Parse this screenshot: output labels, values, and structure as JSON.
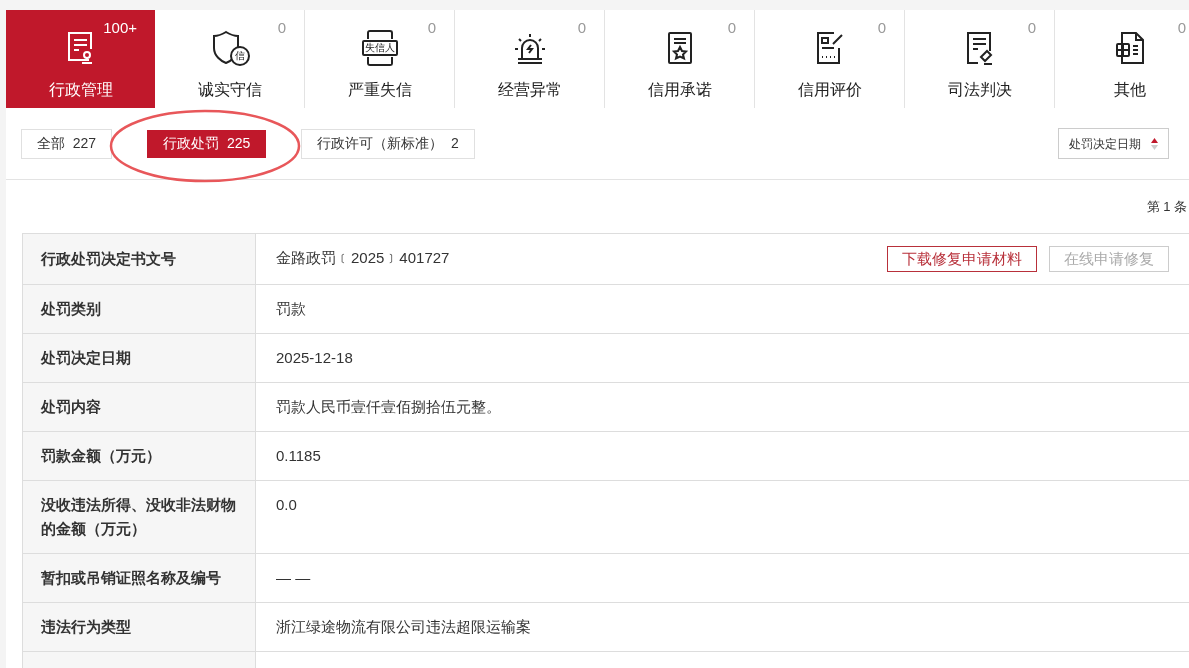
{
  "categories": [
    {
      "label": "行政管理",
      "count": "100+",
      "selected": true
    },
    {
      "label": "诚实守信",
      "count": "0",
      "selected": false,
      "icon_text": "信"
    },
    {
      "label": "严重失信",
      "count": "0",
      "selected": false,
      "icon_text": "失信人"
    },
    {
      "label": "经营异常",
      "count": "0",
      "selected": false
    },
    {
      "label": "信用承诺",
      "count": "0",
      "selected": false
    },
    {
      "label": "信用评价",
      "count": "0",
      "selected": false
    },
    {
      "label": "司法判决",
      "count": "0",
      "selected": false
    },
    {
      "label": "其他",
      "count": "0",
      "selected": false
    }
  ],
  "filters": [
    {
      "label": "全部",
      "count": "227",
      "selected": false
    },
    {
      "label": "行政处罚",
      "count": "225",
      "selected": true
    },
    {
      "label": "行政许可（新标准）",
      "count": "2",
      "selected": false
    }
  ],
  "sort": {
    "label": "处罚决定日期"
  },
  "pager": "第 1 条",
  "record": {
    "rows": [
      {
        "label": "行政处罚决定书文号",
        "value": "金路政罚﹝2025﹞401727"
      },
      {
        "label": "处罚类别",
        "value": "罚款"
      },
      {
        "label": "处罚决定日期",
        "value": "2025-12-18"
      },
      {
        "label": "处罚内容",
        "value": "罚款人民币壹仟壹佰捌拾伍元整。"
      },
      {
        "label": "罚款金额（万元）",
        "value": "0.1185"
      },
      {
        "label": "没收违法所得、没收非法财物的金额（万元）",
        "value": "0.0"
      },
      {
        "label": "暂扣或吊销证照名称及编号",
        "value": "— —"
      },
      {
        "label": "违法行为类型",
        "value": "浙江绿途物流有限公司违法超限运输案"
      }
    ],
    "actions": [
      {
        "label": "下载修复申请材料",
        "disabled": false
      },
      {
        "label": "在线申请修复",
        "disabled": true
      }
    ]
  }
}
